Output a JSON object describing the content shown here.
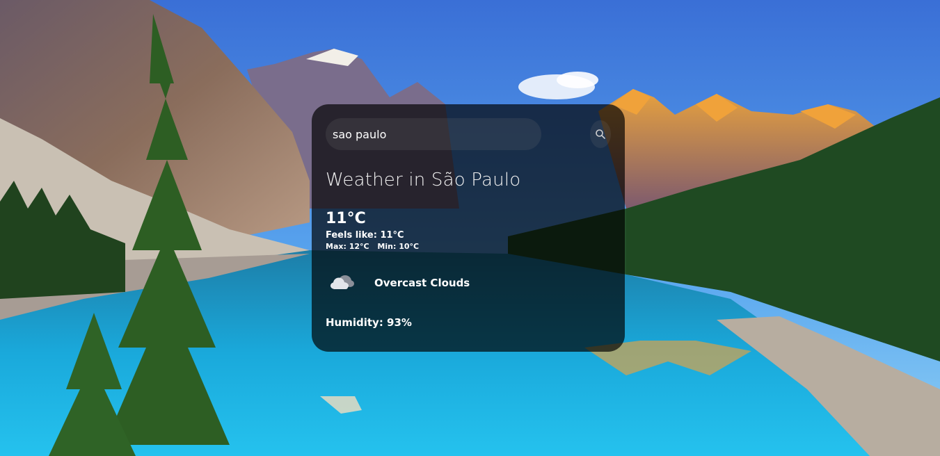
{
  "search": {
    "value": "sao paulo",
    "placeholder": "Search"
  },
  "weather": {
    "city_heading": "Weather in São Paulo",
    "temperature": "11°C",
    "feels_like": "Feels like: 11°C",
    "max": "Max: 12°C",
    "min": "Min: 10°C",
    "description": "Overcast Clouds",
    "humidity": "Humidity: 93%",
    "icon": "overcast-clouds-icon"
  },
  "colors": {
    "card_bg": "#000000",
    "text": "#ffffff",
    "sky": "#4a8fe0",
    "lake": "#1aa6d8",
    "forest": "#1f4a22"
  }
}
